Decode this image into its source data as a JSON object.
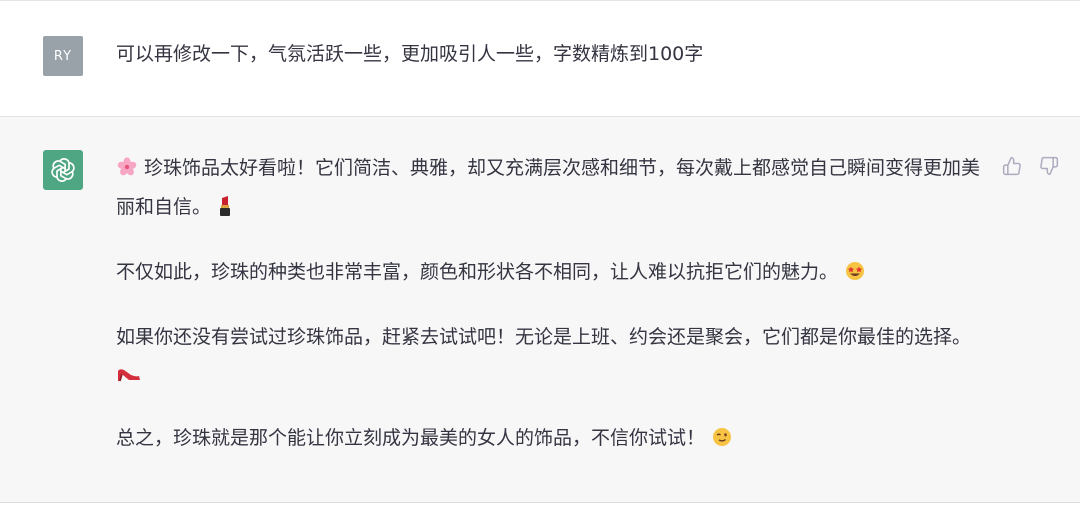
{
  "user_message": {
    "avatar_initials": "RY",
    "text": "可以再修改一下，气氛活跃一些，更加吸引人一些，字数精炼到100字"
  },
  "assistant_message": {
    "paragraphs": [
      {
        "lead_emoji": "cherry-blossom-emoji",
        "text": "珍珠饰品太好看啦！它们简洁、典雅，却又充满层次感和细节，每次戴上都感觉自己瞬间变得更加美丽和自信。",
        "trail_emoji": "lipstick-emoji"
      },
      {
        "text": "不仅如此，珍珠的种类也非常丰富，颜色和形状各不相同，让人难以抗拒它们的魅力。",
        "trail_emoji": "star-struck-emoji"
      },
      {
        "text": "如果你还没有尝试过珍珠饰品，赶紧去试试吧！无论是上班、约会还是聚会，它们都是你最佳的选择。",
        "trail_emoji": "high-heel-emoji"
      },
      {
        "text": "总之，珍珠就是那个能让你立刻成为最美的女人的饰品，不信你试试！",
        "trail_emoji": "winking-face-emoji"
      }
    ]
  },
  "icons": {
    "assistant_avatar": "openai-logo-icon",
    "thumbs_up": "thumbs-up-icon",
    "thumbs_down": "thumbs-down-icon"
  },
  "colors": {
    "assistant_avatar_bg": "#4fa683",
    "user_avatar_bg": "#98a2a8",
    "assistant_row_bg": "#f7f7f8",
    "text": "#343541"
  }
}
